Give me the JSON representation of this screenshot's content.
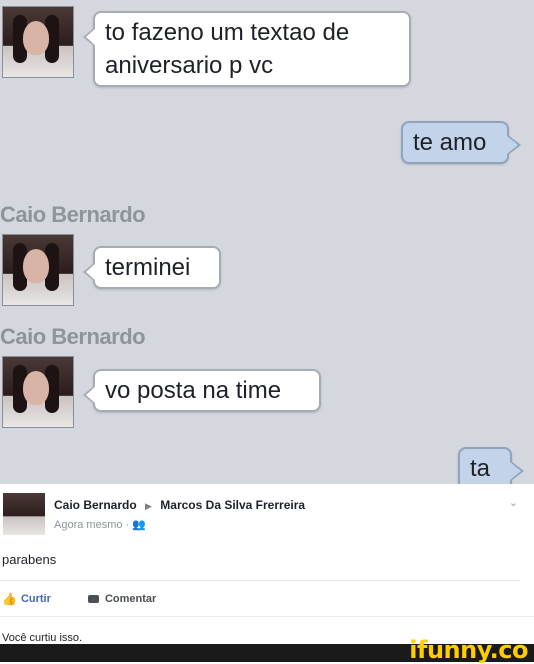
{
  "chat": {
    "messages": [
      {
        "type": "incoming",
        "text_line1": "to fazeno um textao de",
        "text_line2": "aniversario p vc"
      },
      {
        "type": "outgoing",
        "text": "te amo"
      },
      {
        "type": "sender",
        "name": "Caio Bernardo"
      },
      {
        "type": "incoming",
        "text": "terminei"
      },
      {
        "type": "sender",
        "name": "Caio Bernardo"
      },
      {
        "type": "incoming",
        "text": "vo posta na time"
      },
      {
        "type": "outgoing",
        "text": "ta"
      }
    ]
  },
  "post": {
    "author": "Caio Bernardo",
    "target": "Marcos Da Silva Frerreira",
    "time": "Agora mesmo ·",
    "body": "parabens",
    "like_label": "Curtir",
    "comment_label": "Comentar",
    "liked_text": "Você curtiu isso."
  },
  "footer": {
    "brand": "ifunny.co"
  },
  "colors": {
    "chat_bg": "#d4d8de",
    "outgoing_bubble": "#c3d4ea",
    "incoming_bubble": "#ffffff",
    "fb_link": "#4267b2",
    "brand_yellow": "#ffcc00"
  },
  "icons": [
    "arrow-right-icon",
    "audience-icon",
    "chevron-down-icon",
    "like-icon",
    "comment-icon"
  ]
}
